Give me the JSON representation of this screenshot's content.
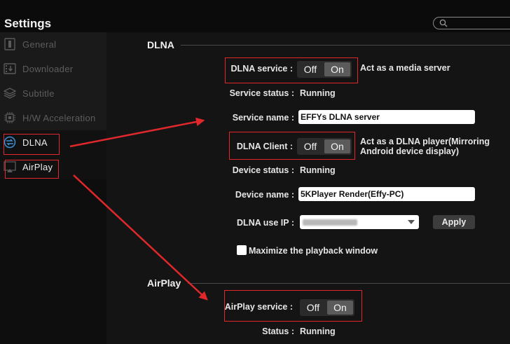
{
  "app": {
    "title": "Settings"
  },
  "search": {
    "icon": "search-icon"
  },
  "sidebar": {
    "items": [
      {
        "label": "General",
        "icon": "general-icon"
      },
      {
        "label": "Downloader",
        "icon": "downloader-icon"
      },
      {
        "label": "Subtitle",
        "icon": "subtitle-icon"
      },
      {
        "label": "H/W Acceleration",
        "icon": "chip-icon"
      },
      {
        "label": "DLNA",
        "icon": "dlna-icon"
      },
      {
        "label": "AirPlay",
        "icon": "airplay-icon"
      }
    ],
    "active": "DLNA"
  },
  "dlna": {
    "section_title": "DLNA",
    "service_label": "DLNA service :",
    "service_off": "Off",
    "service_on": "On",
    "service_desc": "Act as a media server",
    "service_status_label": "Service status :",
    "service_status_value": "Running",
    "service_name_label": "Service name :",
    "service_name_value": "EFFYs DLNA server",
    "client_label": "DLNA Client :",
    "client_off": "Off",
    "client_on": "On",
    "client_desc_1": "Act as a DLNA player(Mirroring",
    "client_desc_2": "Android device display)",
    "device_status_label": "Device status :",
    "device_status_value": "Running",
    "device_name_label": "Device name :",
    "device_name_value": "5KPlayer Render(Effy-PC)",
    "use_ip_label": "DLNA use IP :",
    "apply_label": "Apply",
    "maximize_label": "Maximize the playback window"
  },
  "airplay": {
    "section_title": "AirPlay",
    "service_label": "AirPlay service :",
    "service_off": "Off",
    "service_on": "On",
    "status_label": "Status :",
    "status_value": "Running"
  },
  "colors": {
    "annotation": "#e0282c",
    "background": "#141414",
    "sidebar": "#0e0e0e"
  }
}
